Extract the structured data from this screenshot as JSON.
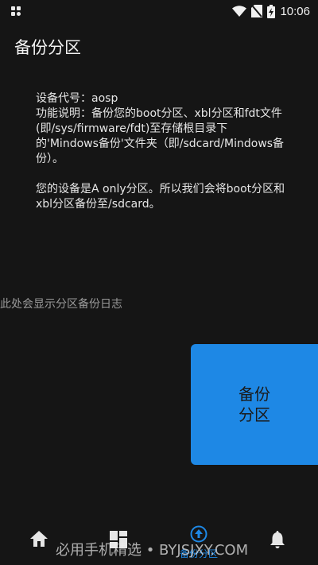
{
  "status_bar": {
    "time": "10:06",
    "icons": [
      "notification-icon",
      "wifi-icon",
      "no-sim-icon",
      "battery-charging-icon"
    ]
  },
  "app_title": "备份分区",
  "info": {
    "device_line": "设备代号：aosp",
    "description": "功能说明：备份您的boot分区、xbl分区和fdt文件(即/sys/firmware/fdt)至存储根目录下的'Mindows备份'文件夹（即/sdcard/Mindows备份）。",
    "device_status": "您的设备是A only分区。所以我们会将boot分区和xbl分区备份至/sdcard。"
  },
  "log_placeholder": "此处会显示分区备份日志",
  "backup_button": "备份分区",
  "bottom_nav": {
    "items": [
      {
        "icon": "home-icon",
        "label": ""
      },
      {
        "icon": "dashboard-icon",
        "label": ""
      },
      {
        "icon": "backup-upload-icon",
        "label": "备份分区",
        "active": true
      },
      {
        "icon": "bell-icon",
        "label": ""
      }
    ]
  },
  "watermark": "必用手机精选 • BYJSJXY.COM",
  "colors": {
    "accent": "#1e88e5",
    "background": "#151515",
    "text": "#e8e8e8",
    "muted": "#9a9a9a"
  }
}
